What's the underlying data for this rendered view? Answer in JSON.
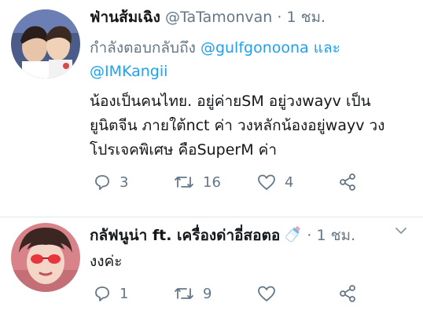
{
  "tweets": [
    {
      "display_name": "ฟ่านส้มเฉิง",
      "handle": "@TaTamonvan",
      "separator": "·",
      "time": "1 ชม.",
      "reply_prefix": "กำลังตอบกลับถึง",
      "reply_mentions": [
        "@gulfgonoona",
        "@IMKangii"
      ],
      "reply_joiner": "และ",
      "body_lines": [
        "น้องเป็นคนไทย. อยู่ค่ายSM อยู่วงwayv เป็น",
        "ยูนิตจีน ภายใต้nct ค่า วงหลักน้องอยู่wayv วง",
        "โปรเจคพิเศษ คือSuperM ค่า"
      ],
      "replies": "3",
      "retweets": "16",
      "likes": "4"
    },
    {
      "display_name": "กลัฟนูน่า ft. เครื่องด่าอี่สอตอ",
      "handle": "",
      "separator": "·",
      "time": "1 ชม.",
      "body": "งงค่ะ",
      "replies": "1",
      "retweets": "9",
      "likes": ""
    }
  ],
  "icons": {
    "reply": "reply-icon",
    "retweet": "retweet-icon",
    "like": "heart-icon",
    "share": "share-icon",
    "caret": "chevron-down-icon",
    "emoji": "baby-bottle-icon"
  },
  "colors": {
    "link": "#1da1f2",
    "secondary": "#657786",
    "text": "#14171a"
  }
}
